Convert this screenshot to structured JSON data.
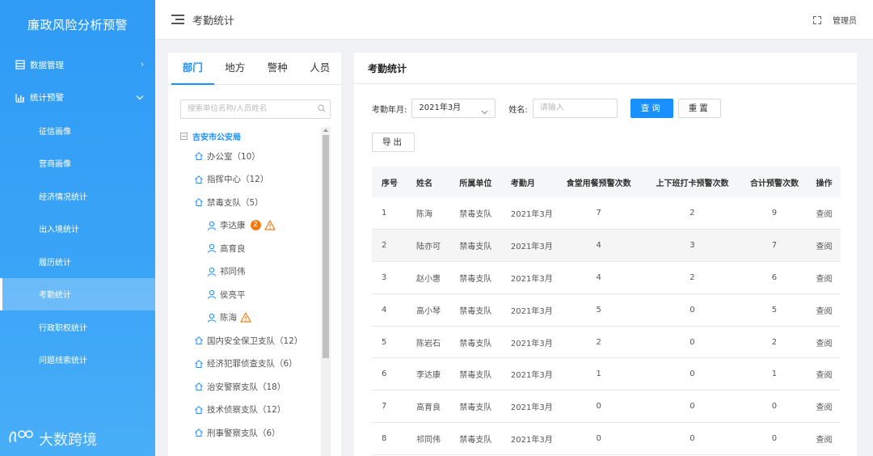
{
  "sidebar": {
    "title": "廉政风险分析预警",
    "menu": [
      {
        "label": "数据管理",
        "icon": "list-icon",
        "chevron": "›"
      },
      {
        "label": "统计预警",
        "icon": "bar-chart-icon",
        "chevron": "⌄"
      }
    ],
    "sub_items": [
      "征信画像",
      "营商画像",
      "经济情况统计",
      "出入境统计",
      "履历统计",
      "考勤统计",
      "行政职权统计",
      "问题线索统计"
    ],
    "active_sub": "考勤统计",
    "logo_text": "大数跨境"
  },
  "header": {
    "title": "考勤统计",
    "user": "管理员"
  },
  "left_panel": {
    "tabs": [
      "部门",
      "地方",
      "警种",
      "人员"
    ],
    "search_placeholder": "搜索单位名称/人员姓名",
    "tree": {
      "root": "吉安市公安局",
      "nodes": [
        {
          "label": "办公室（10）",
          "type": "dept"
        },
        {
          "label": "指挥中心（12）",
          "type": "dept"
        },
        {
          "label": "禁毒支队（5）",
          "type": "dept"
        },
        {
          "label": "李达康",
          "type": "person",
          "badge": "2",
          "warn": true
        },
        {
          "label": "高育良",
          "type": "person"
        },
        {
          "label": "祁同伟",
          "type": "person"
        },
        {
          "label": "侯亮平",
          "type": "person"
        },
        {
          "label": "陈海",
          "type": "person",
          "warn": true
        },
        {
          "label": "国内安全保卫支队（12）",
          "type": "dept"
        },
        {
          "label": "经济犯罪侦查支队（6）",
          "type": "dept"
        },
        {
          "label": "治安警察支队（18）",
          "type": "dept"
        },
        {
          "label": "技术侦察支队（12）",
          "type": "dept"
        },
        {
          "label": "刑事警察支队（6）",
          "type": "dept"
        }
      ]
    }
  },
  "right_panel": {
    "title": "考勤统计",
    "form": {
      "month_label": "考勤年月:",
      "month_value": "2021年3月",
      "name_label": "姓名:",
      "name_placeholder": "请输入",
      "query_label": "查询",
      "reset_label": "重置",
      "export_label": "导出"
    },
    "table": {
      "headers": [
        "序号",
        "姓名",
        "所属单位",
        "考勤月",
        "食堂用餐预警次数",
        "上下班打卡预警次数",
        "合计预警次数",
        "操作"
      ],
      "rows": [
        [
          "1",
          "陈海",
          "禁毒支队",
          "2021年3月",
          "7",
          "2",
          "9",
          "查阅"
        ],
        [
          "2",
          "陆亦可",
          "禁毒支队",
          "2021年3月",
          "4",
          "3",
          "7",
          "查阅"
        ],
        [
          "3",
          "赵小惠",
          "禁毒支队",
          "2021年3月",
          "4",
          "2",
          "6",
          "查阅"
        ],
        [
          "4",
          "高小琴",
          "禁毒支队",
          "2021年3月",
          "5",
          "0",
          "5",
          "查阅"
        ],
        [
          "5",
          "陈岩石",
          "禁毒支队",
          "2021年3月",
          "2",
          "0",
          "2",
          "查阅"
        ],
        [
          "6",
          "李达康",
          "禁毒支队",
          "2021年3月",
          "1",
          "0",
          "1",
          "查阅"
        ],
        [
          "7",
          "高育良",
          "禁毒支队",
          "2021年3月",
          "0",
          "0",
          "0",
          "查阅"
        ],
        [
          "8",
          "祁同伟",
          "禁毒支队",
          "2021年3月",
          "0",
          "0",
          "0",
          "查阅"
        ]
      ]
    }
  },
  "colors": {
    "primary": "#1890ff",
    "sidebar": "#3aa4f7",
    "badge": "#f07d13",
    "warn": "#f07d13"
  }
}
